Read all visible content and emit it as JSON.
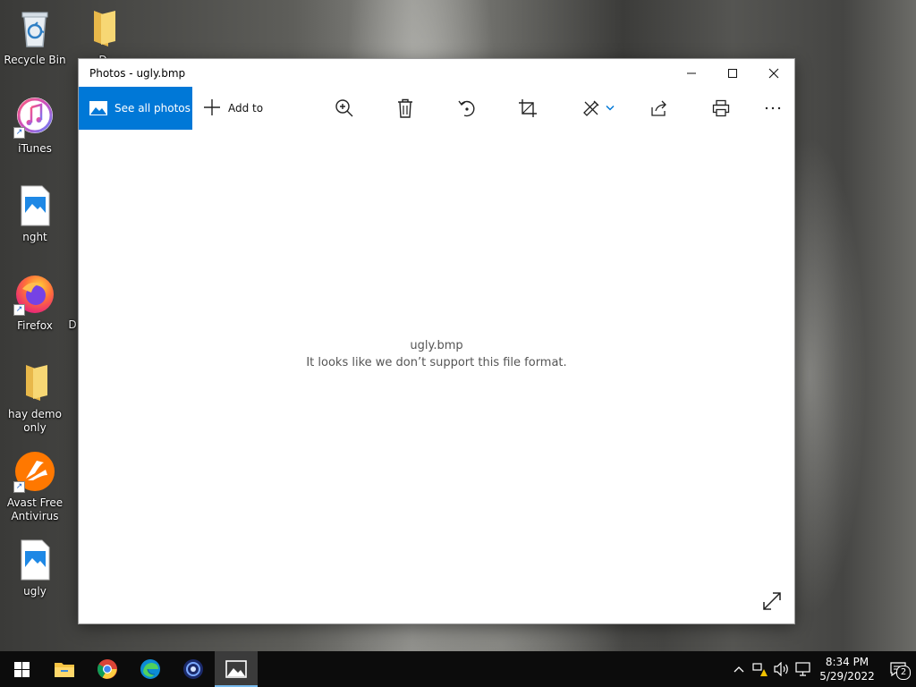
{
  "desktop": {
    "icons": [
      {
        "label": "Recycle Bin",
        "icon": "recycle-bin-icon"
      },
      {
        "label": "iTunes",
        "icon": "itunes-icon"
      },
      {
        "label": "nght",
        "icon": "image-file-icon"
      },
      {
        "label": "Firefox",
        "icon": "firefox-icon"
      },
      {
        "label": "hay demo only",
        "icon": "folder-icon"
      },
      {
        "label": "Avast Free Antivirus",
        "icon": "avast-icon"
      },
      {
        "label": "ugly",
        "icon": "image-file-icon"
      },
      {
        "label": "D",
        "icon": "folder-icon"
      },
      {
        "label": "D",
        "icon": "partial-icon"
      }
    ]
  },
  "window": {
    "title": "Photos - ugly.bmp",
    "controls": {
      "minimize": "–",
      "maximize": "☐",
      "close": "✕"
    },
    "toolbar": {
      "see_all_label": "See all photos",
      "add_to_label": "Add to"
    },
    "message": {
      "filename": "ugly.bmp",
      "text": "It looks like we don’t support this file format."
    },
    "accent": "#0078d7"
  },
  "taskbar": {
    "apps": [
      "start",
      "file-explorer",
      "chrome",
      "edge",
      "app",
      "photos"
    ],
    "time": "8:34 PM",
    "date": "5/29/2022",
    "notification_count": "2"
  }
}
